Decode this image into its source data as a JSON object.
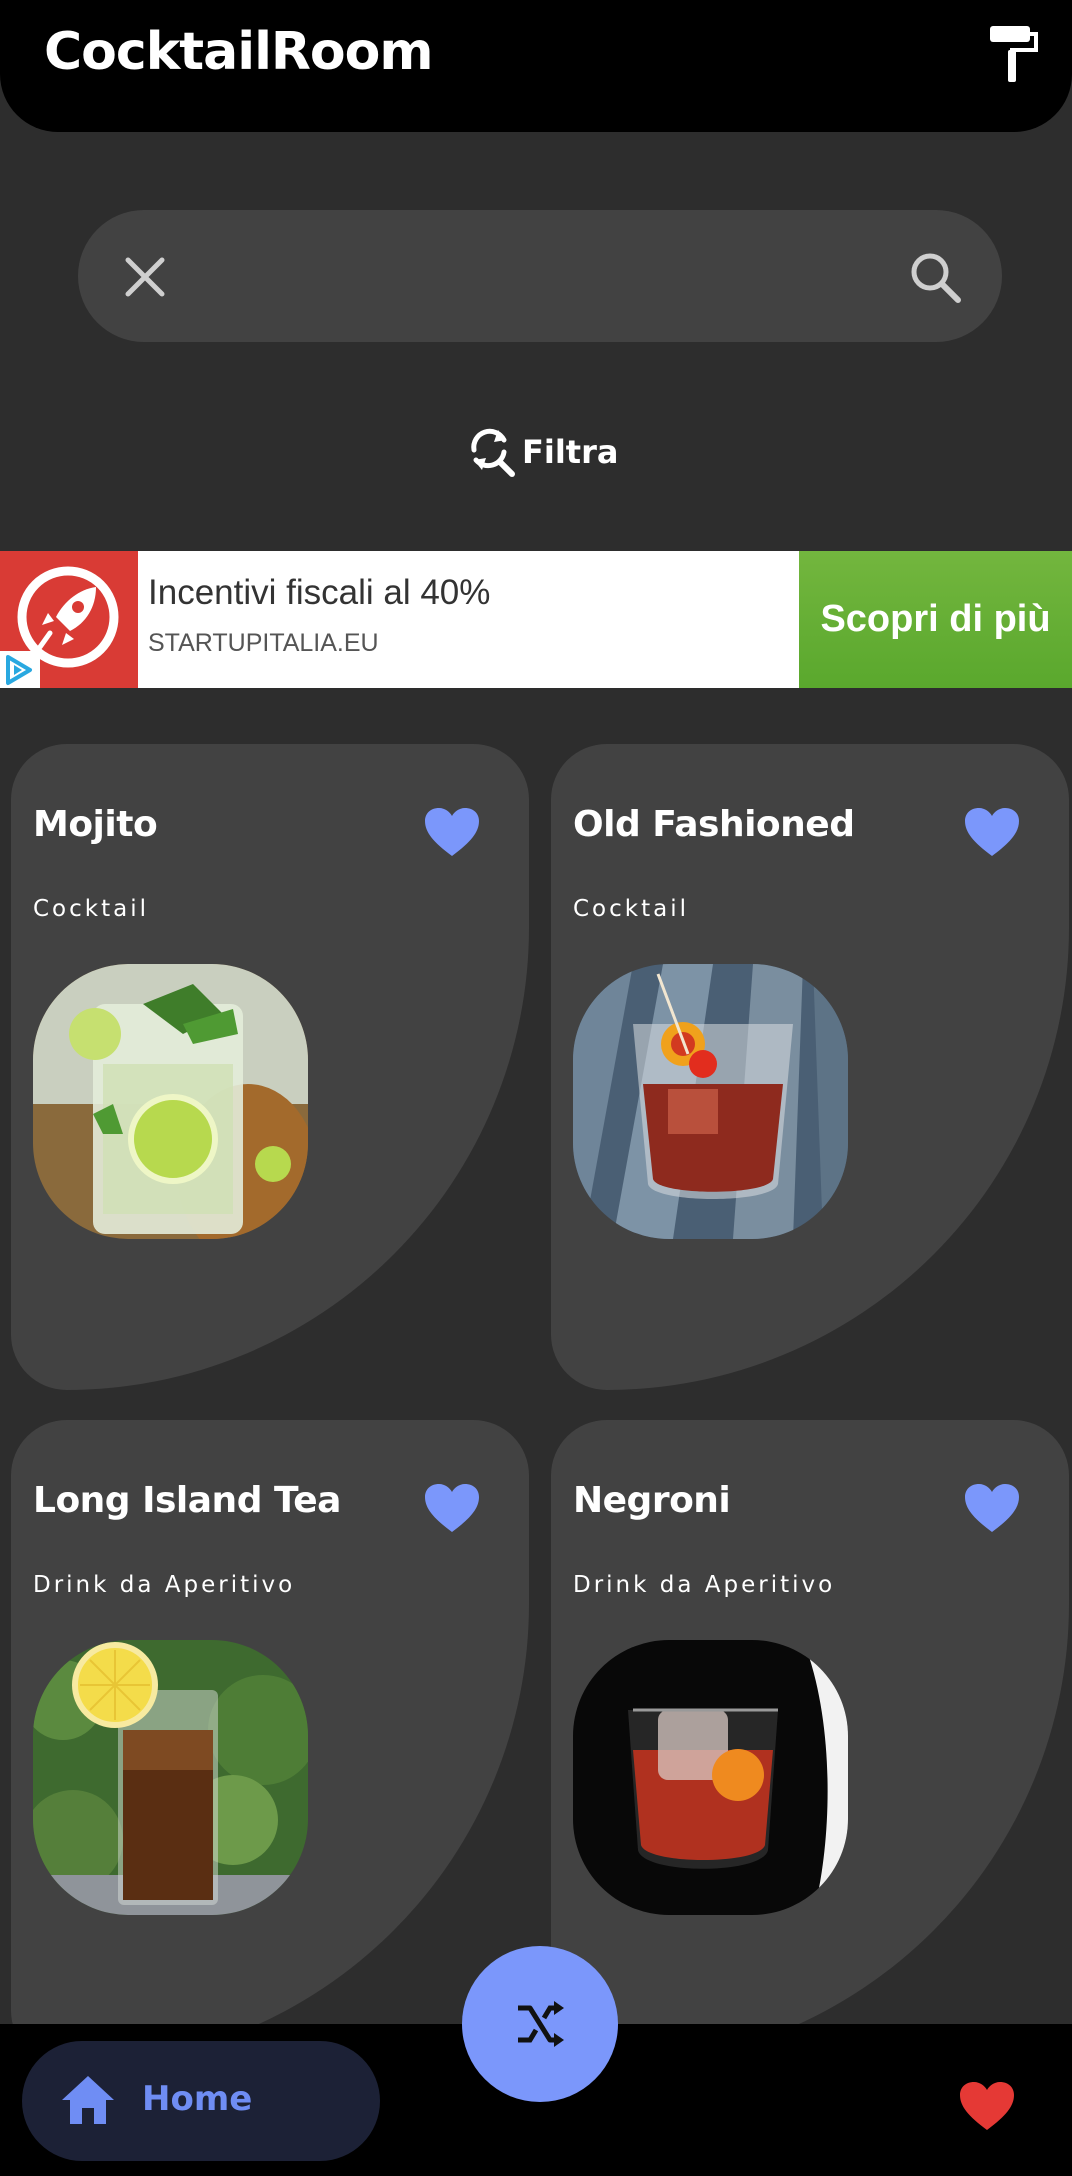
{
  "app": {
    "title": "CocktailRoom"
  },
  "search": {
    "value": "",
    "placeholder": ""
  },
  "filter": {
    "label": "Filtra"
  },
  "ad": {
    "title": "Incentivi fiscali al 40%",
    "domain": "STARTUPITALIA.EU",
    "cta": "Scopri di più"
  },
  "cocktails": [
    {
      "name": "Mojito",
      "category": "Cocktail",
      "favorite_icon": "heart-icon"
    },
    {
      "name": "Old Fashioned",
      "category": "Cocktail",
      "favorite_icon": "heart-icon"
    },
    {
      "name": "Long Island Tea",
      "category": "Drink da Aperitivo",
      "favorite_icon": "heart-icon"
    },
    {
      "name": "Negroni",
      "category": "Drink da Aperitivo",
      "favorite_icon": "heart-icon"
    }
  ],
  "nav": {
    "home_label": "Home",
    "favorites_icon": "heart-icon"
  },
  "colors": {
    "accent": "#7b97fb",
    "favorite_heart": "#e53935",
    "card": "#424242",
    "background": "#2d2d2d"
  }
}
